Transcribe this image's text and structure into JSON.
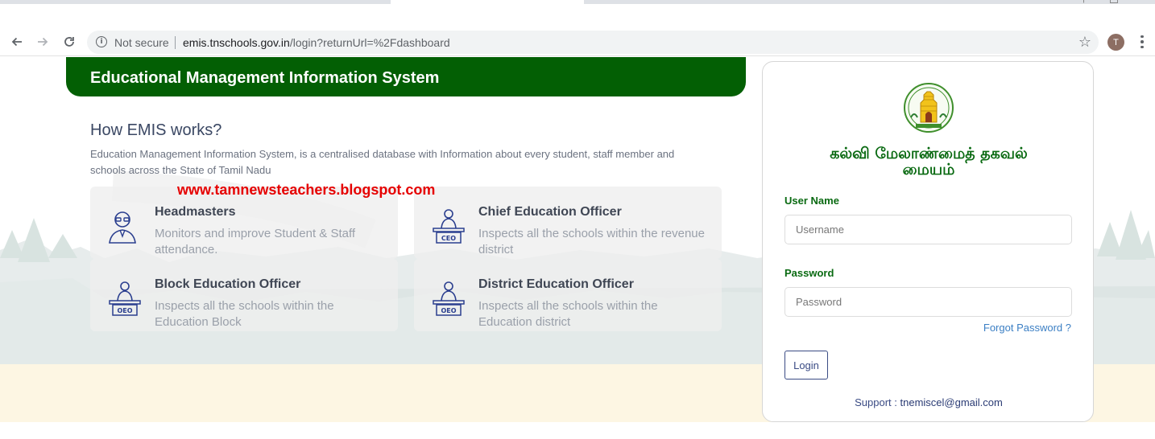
{
  "browser": {
    "security_label": "Not secure",
    "url_host": "emis.tnschools.gov.in",
    "url_path": "/login?returnUrl=%2Fdashboard",
    "avatar_letter": "T"
  },
  "banner": {
    "title": "Educational Management Information System"
  },
  "intro": {
    "heading": "How EMIS works?",
    "description": "Education Management Information System, is a centralised database with Information about every student, staff member and schools across the State of Tamil Nadu"
  },
  "watermark": "www.tamnewsteachers.blogspot.com",
  "roles": [
    {
      "title": "Headmasters",
      "description": "Monitors and improve Student & Staff attendance.",
      "icon": "headmaster-icon"
    },
    {
      "title": "Chief Education Officer",
      "description": "Inspects all the schools within the revenue district",
      "icon": "ceo-officer-icon",
      "badge": "CEO"
    },
    {
      "title": "Block Education Officer",
      "description": "Inspects all the schools within the Education Block",
      "icon": "beo-officer-icon",
      "badge": "OEO"
    },
    {
      "title": "District Education Officer",
      "description": "Inspects all the schools within the Education district",
      "icon": "deo-officer-icon",
      "badge": "OEO"
    }
  ],
  "login": {
    "title_line1": "கல்வி மேலாண்மைத் தகவல்",
    "title_line2": "மையம்",
    "username_label": "User Name",
    "username_placeholder": "Username",
    "password_label": "Password",
    "password_placeholder": "Password",
    "forgot_label": "Forgot Password ?",
    "login_label": "Login",
    "support_label": "Support : ",
    "support_email": "tnemiscel@gmail.com"
  },
  "colors": {
    "banner_green": "#035f04",
    "label_green": "#0a6a12",
    "link_blue": "#3b7fc4",
    "watermark_red": "#e60000",
    "button_navy": "#3a4b84"
  }
}
